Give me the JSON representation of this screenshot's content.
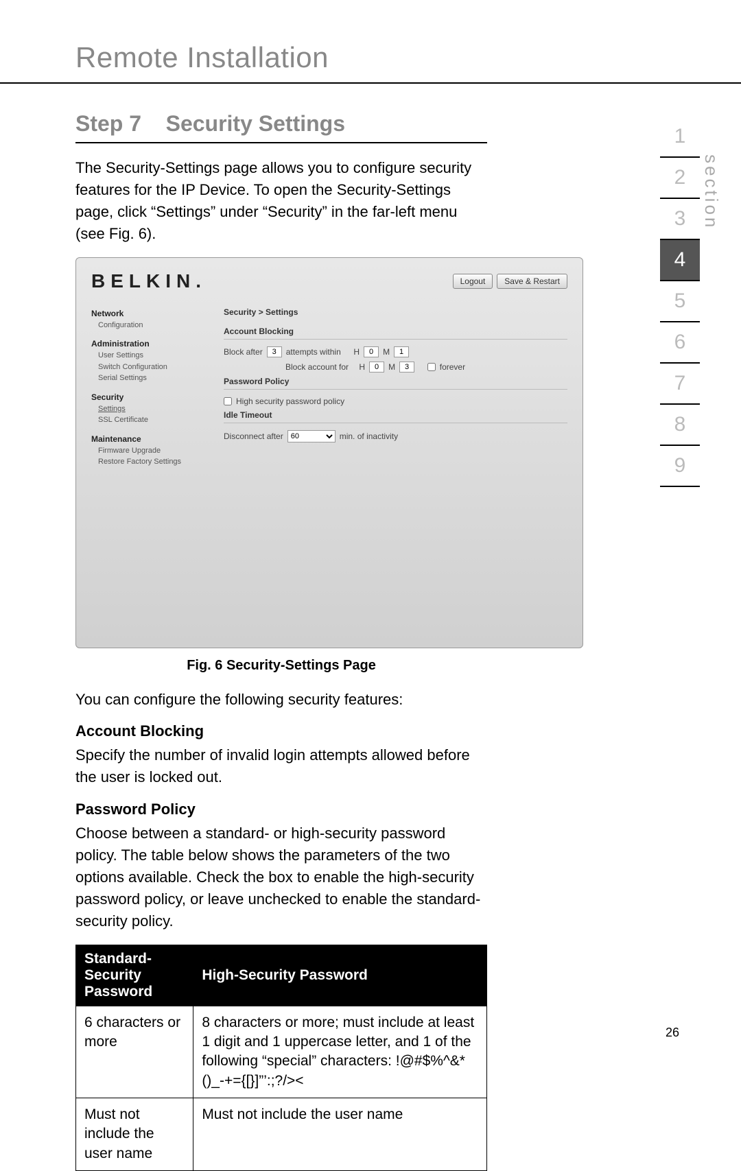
{
  "header": {
    "title": "Remote Installation"
  },
  "section_nav": {
    "label": "section",
    "items": [
      "1",
      "2",
      "3",
      "4",
      "5",
      "6",
      "7",
      "8",
      "9"
    ],
    "active_index": 3
  },
  "step": {
    "prefix": "Step 7",
    "title": "Security Settings"
  },
  "intro_text": "The Security-Settings page allows you to configure security features for the IP Device. To open the Security-Settings page, click “Settings” under “Security” in the far-left menu (see Fig. 6).",
  "figure": {
    "caption": "Fig. 6 Security-Settings Page"
  },
  "ui": {
    "logo": "BELKIN.",
    "buttons": {
      "logout": "Logout",
      "save": "Save & Restart"
    },
    "sidebar": {
      "groups": [
        {
          "title": "Network",
          "items": [
            "Configuration"
          ]
        },
        {
          "title": "Administration",
          "items": [
            "User Settings",
            "Switch Configuration",
            "Serial Settings"
          ]
        },
        {
          "title": "Security",
          "items": [
            "Settings",
            "SSL Certificate"
          ],
          "active": 0
        },
        {
          "title": "Maintenance",
          "items": [
            "Firmware Upgrade",
            "Restore Factory Settings"
          ]
        }
      ]
    },
    "main": {
      "breadcrumb": "Security > Settings",
      "account_blocking": {
        "heading": "Account Blocking",
        "block_after_label": "Block after",
        "block_after_value": "3",
        "attempts_label": "attempts within",
        "h_label": "H",
        "h_value": "0",
        "m_label": "M",
        "m_value": "1",
        "block_for_label": "Block account for",
        "h2_value": "0",
        "m2_value": "3",
        "forever_label": "forever"
      },
      "password_policy": {
        "heading": "Password Policy",
        "checkbox_label": "High security password policy"
      },
      "idle_timeout": {
        "heading": "Idle Timeout",
        "label": "Disconnect after",
        "value": "60",
        "suffix": "min. of inactivity"
      }
    }
  },
  "lead_out": "You can configure the following security features:",
  "account_blocking": {
    "heading": "Account Blocking",
    "text": "Specify the number of invalid login attempts allowed before the user is locked out."
  },
  "password_policy": {
    "heading": "Password Policy",
    "text": "Choose between a standard- or high-security password policy. The table below shows the parameters of the two options available. Check the box to enable the high-security password policy, or leave unchecked to enable the standard-security policy."
  },
  "table": {
    "headers": [
      "Standard-Security Password",
      "High-Security Password"
    ],
    "rows": [
      [
        "6 characters or more",
        "8 characters or more; must include at least 1 digit and 1 uppercase letter, and 1 of the following “special” characters: !@#$%^&*()_-+={[}]”’:;?/><"
      ],
      [
        "Must not include the user name",
        "Must not include the user name"
      ]
    ]
  },
  "page_number": "26"
}
